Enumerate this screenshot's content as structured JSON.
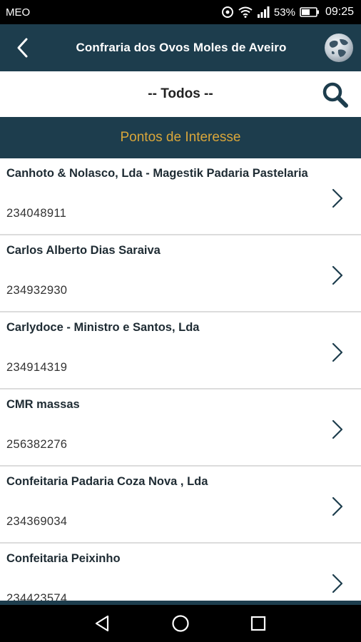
{
  "status_bar": {
    "carrier": "MEO",
    "battery": "53%",
    "time": "09:25",
    "icons": [
      "sync-icon",
      "wifi-icon",
      "signal-icon",
      "battery-icon"
    ]
  },
  "app_bar": {
    "title": "Confraria dos Ovos Moles de Aveiro",
    "icons": [
      "back-icon",
      "globe-icon"
    ]
  },
  "filter": {
    "label": "-- Todos --",
    "icon": "search-icon"
  },
  "section": {
    "title": "Pontos de Interesse"
  },
  "items": [
    {
      "name": "Canhoto & Nolasco, Lda - Magestik  Padaria Pastelaria",
      "phone": "234048911"
    },
    {
      "name": "Carlos Alberto Dias Saraiva",
      "phone": "234932930"
    },
    {
      "name": "Carlydoce - Ministro e Santos, Lda",
      "phone": "234914319"
    },
    {
      "name": "CMR massas",
      "phone": "256382276"
    },
    {
      "name": "Confeitaria Padaria Coza Nova , Lda",
      "phone": "234369034"
    },
    {
      "name": "Confeitaria Peixinho",
      "phone": "234423574"
    }
  ],
  "colors": {
    "primary": "#1d3d4d",
    "accent": "#d9a63a",
    "divider": "#dcdcdc"
  },
  "nav_bar": {
    "icons": [
      "nav-back-icon",
      "home-icon",
      "recents-icon"
    ]
  }
}
